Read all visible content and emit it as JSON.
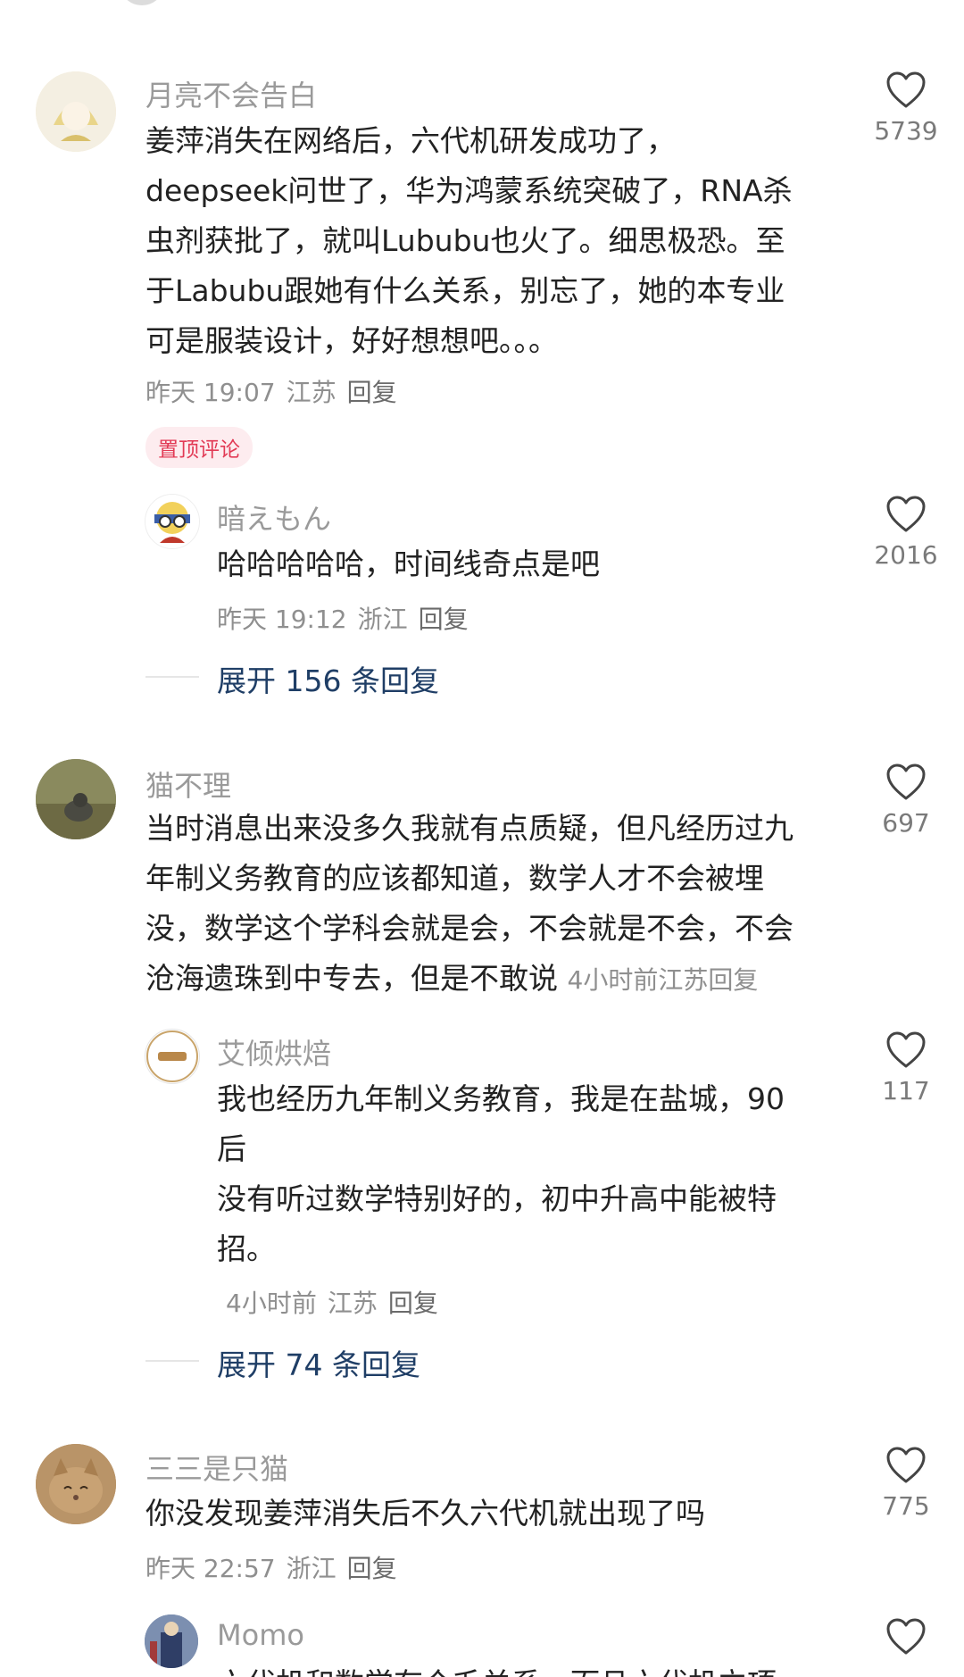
{
  "comments": [
    {
      "username": "月亮不会告白",
      "text_lines": [
        "姜萍消失在网络后，六代机研发成功了，",
        "deepseek问世了，华为鸿蒙系统突破了，RNA杀",
        "虫剂获批了，就叫Lububu也火了。细思极恐。至",
        "于Labubu跟她有什么关系，别忘了，她的本专业",
        "可是服装设计，好好想想吧。。。"
      ],
      "time": "昨天 19:07",
      "location": "江苏",
      "reply_label": "回复",
      "likes": "5739",
      "badge": "置顶评论",
      "replies": [
        {
          "username": "暗えもん",
          "text": "哈哈哈哈哈，时间线奇点是吧",
          "time": "昨天 19:12",
          "location": "浙江",
          "reply_label": "回复",
          "likes": "2016"
        }
      ],
      "expand_label": "展开 156 条回复"
    },
    {
      "username": "猫不理",
      "text_lines": [
        "当时消息出来没多久我就有点质疑，但凡经历过九",
        "年制义务教育的应该都知道，数学人才不会被埋",
        "没，数学这个学科会就是会，不会就是不会，不会",
        "沧海遗珠到中专去，但是不敢说"
      ],
      "time": "4小时前",
      "location": "江苏",
      "reply_label": "回复",
      "likes": "697",
      "replies": [
        {
          "username": "艾倾烘焙",
          "text_lines": [
            "我也经历九年制义务教育，我是在盐城，90",
            "后",
            "没有听过数学特别好的，初中升高中能被特",
            "招。"
          ],
          "time": "4小时前",
          "location": "江苏",
          "reply_label": "回复",
          "likes": "117"
        }
      ],
      "expand_label": "展开 74 条回复"
    },
    {
      "username": "三三是只猫",
      "text": "你没发现姜萍消失后不久六代机就出现了吗",
      "time": "昨天 22:57",
      "location": "浙江",
      "reply_label": "回复",
      "likes": "775",
      "replies": [
        {
          "username": "Momo",
          "text_partial": "六代机和数学有个毛关系，而且六代机立项"
        }
      ]
    }
  ],
  "icons": {
    "like": "heart-outline-icon"
  },
  "colors": {
    "badge_text": "#e23a55",
    "badge_bg": "#fdecef",
    "expand_link": "#1f3e66"
  }
}
